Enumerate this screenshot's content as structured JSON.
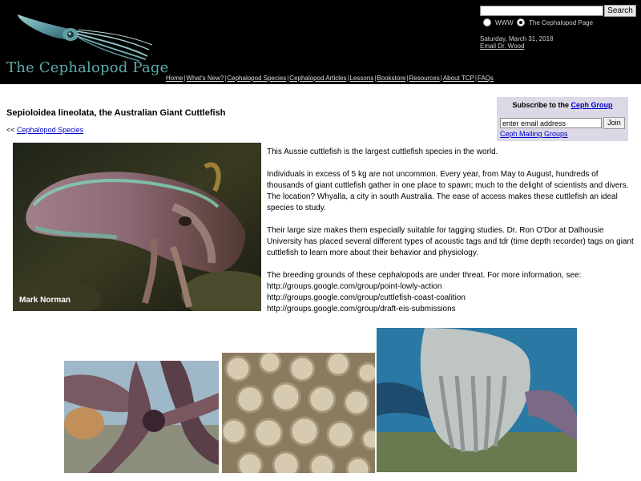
{
  "header": {
    "site_title": "The Cephalopod Page",
    "search_button": "Search",
    "search_value": "",
    "radio_options": [
      "WWW",
      "The Cephalopod Page"
    ],
    "selected_radio": "The Cephalopod Page",
    "date": "Saturday, March 31, 2018",
    "email_link": "Email Dr. Wood",
    "nav": [
      "Home",
      "What's New?",
      "Cephalopod Species",
      "Cephalopod Articles",
      "Lessons",
      "Bookstore",
      "Resources",
      "About TCP",
      "FAQs"
    ],
    "nav_separator": "|",
    "logo_icon": "squid-logo-icon"
  },
  "page": {
    "title": "Sepioloidea lineolata, the Australian Giant Cuttlefish",
    "back_prefix": "<<",
    "back_link": "Cephalopod Species",
    "photo_credit": "Mark Norman",
    "paragraphs": [
      "This Aussie cuttlefish is the largest cuttlefish species in the world.",
      "Individuals in excess of 5 kg are not uncommon. Every year, from May to August, hundreds of thousands of giant cuttlefish gather in one place to spawn; much to the delight of scientists and divers. The location? Whyalla, a city in south Australia. The ease of access makes these cuttlefish an ideal species to study.",
      "Their large size makes them especially suitable for tagging studies. Dr. Ron O'Dor at Dalhousie University has placed several different types of acoustic tags and tdr (time depth recorder) tags on giant cuttlefish to learn more about their behavior and physiology.",
      "The breeding grounds of these cephalopods are under threat. For more information, see:"
    ],
    "links": [
      "http://groups.google.com/group/point-lowly-action",
      "http://groups.google.com/group/cuttlefish-coast-coalition",
      "http://groups.google.com/group/draft-eis-submissions"
    ]
  },
  "subscribe": {
    "title_prefix": "Subscribe to the",
    "title_link": "Ceph Group",
    "email_placeholder": "enter email address",
    "email_value": "enter email address",
    "join_button": "Join",
    "mailing_link": "Ceph Mailing Groups"
  },
  "colors": {
    "header_bg": "#000000",
    "title_teal": "#5fa9a8",
    "subscribe_bg": "#dcd8e6",
    "link_blue": "#0000cc"
  }
}
